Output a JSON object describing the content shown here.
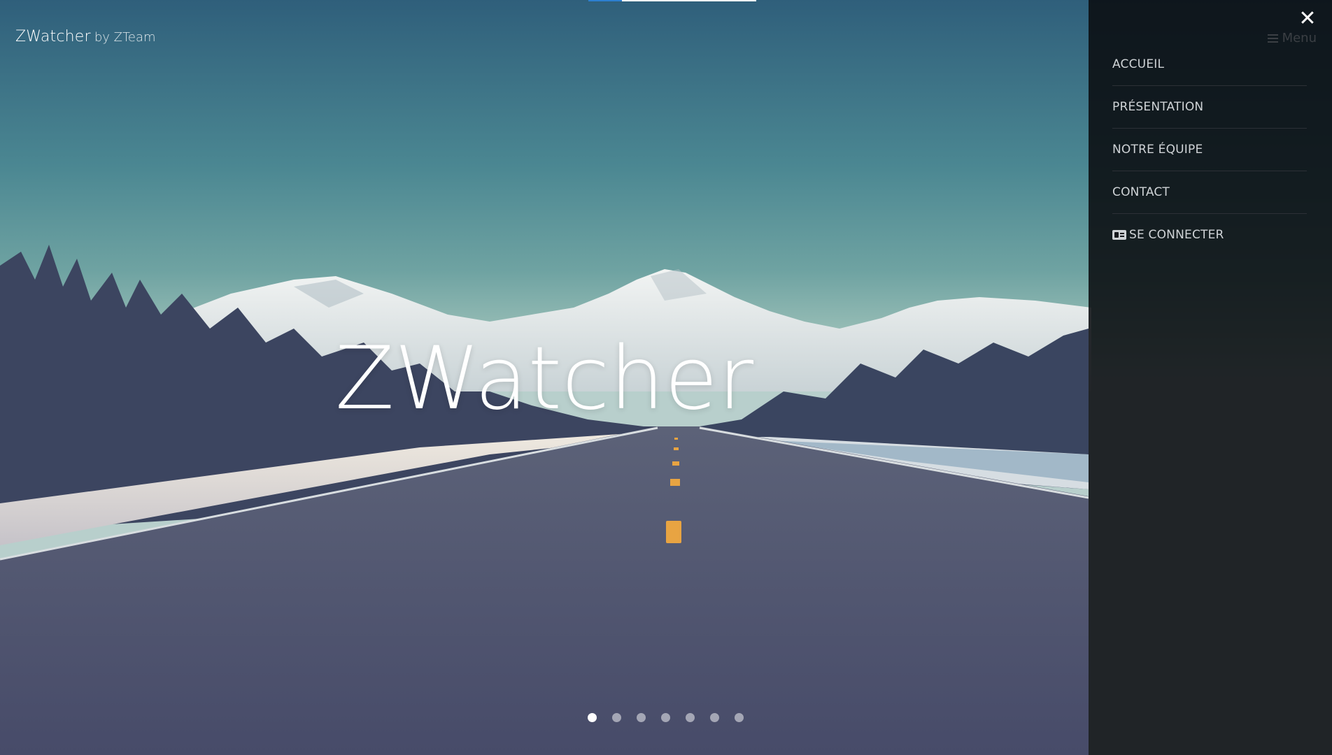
{
  "site": {
    "brand_name": "ZWatcher",
    "brand_by": "by ZTeam",
    "hero_title": "ZWatcher"
  },
  "slider": {
    "slide_count": 7,
    "active_index": 0
  },
  "menu": {
    "toggle_label": "Menu",
    "close_icon": "close-icon",
    "items": [
      {
        "label": "ACCUEIL"
      },
      {
        "label": "PRÉSENTATION"
      },
      {
        "label": "NOTRE ÉQUIPE"
      },
      {
        "label": "CONTACT"
      },
      {
        "label": "SE CONNECTER",
        "icon": "id-card-icon"
      }
    ]
  },
  "colors": {
    "panel_bg": "#0a0c10",
    "menu_text": "#cfd3d6",
    "accent": "#2c7fd0"
  }
}
